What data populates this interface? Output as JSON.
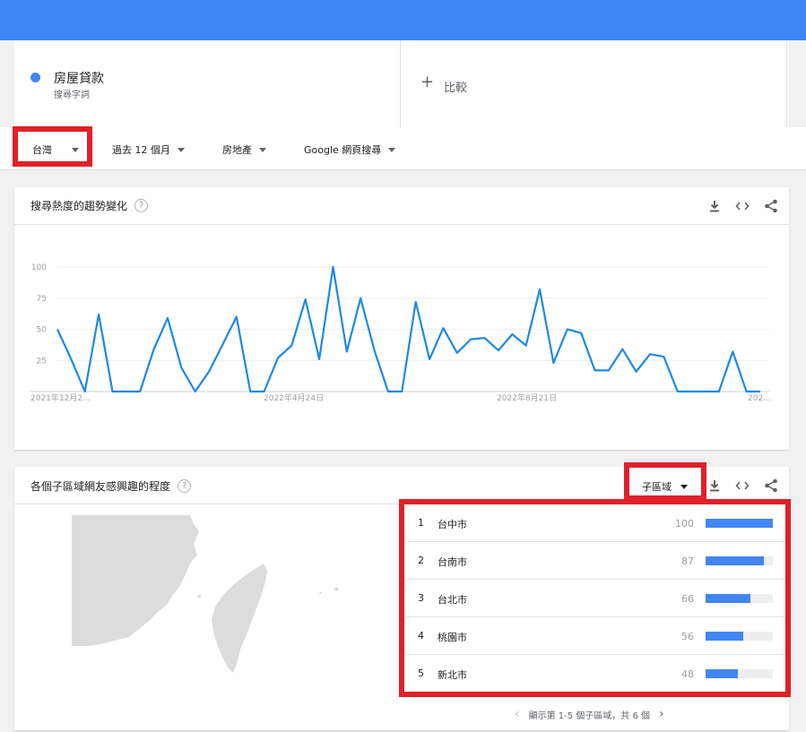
{
  "search_term": {
    "name": "房屋貸款",
    "type": "搜尋字詞",
    "color": "#4285f4"
  },
  "compare": {
    "label": "比較"
  },
  "filters": [
    {
      "label": "台灣"
    },
    {
      "label": "過去 12 個月"
    },
    {
      "label": "房地產"
    },
    {
      "label": "Google 網頁搜尋"
    }
  ],
  "trend_card": {
    "title": "搜尋熱度的趨勢變化",
    "help": "?"
  },
  "region_card": {
    "title": "各個子區域網友感興趣的程度",
    "help": "?",
    "resolution": "子區域",
    "pager": "顯示第 1-5 個子區域，共 6 個"
  },
  "regions": [
    {
      "rank": "1",
      "name": "台中市",
      "value": 100
    },
    {
      "rank": "2",
      "name": "台南市",
      "value": 87
    },
    {
      "rank": "3",
      "name": "台北市",
      "value": 66
    },
    {
      "rank": "4",
      "name": "桃園市",
      "value": 56
    },
    {
      "rank": "5",
      "name": "新北市",
      "value": 48
    }
  ],
  "chart_data": {
    "type": "line",
    "x_tick_labels": [
      "2021年12月2...",
      "2022年4月24日",
      "2022年8月21日",
      "202..."
    ],
    "y_ticks": [
      25,
      50,
      75,
      100
    ],
    "ylim": [
      0,
      100
    ],
    "grid": true,
    "series": [
      {
        "color": "#1e88e5",
        "values": [
          50,
          26,
          0,
          62,
          0,
          0,
          0,
          34,
          59,
          19,
          0,
          16,
          38,
          60,
          0,
          0,
          27,
          37,
          74,
          26,
          100,
          32,
          75,
          33,
          0,
          0,
          72,
          26,
          51,
          31,
          42,
          43,
          33,
          46,
          37,
          82,
          23,
          50,
          47,
          17,
          17,
          34,
          16,
          30,
          28,
          0,
          0,
          0,
          0,
          32,
          0,
          0
        ]
      }
    ]
  }
}
